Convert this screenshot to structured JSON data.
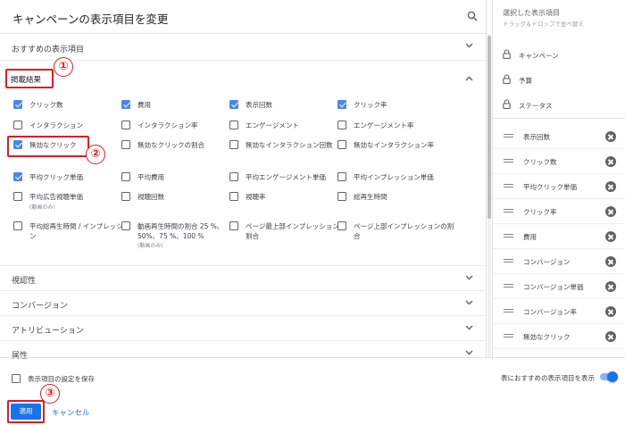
{
  "dialog": {
    "title": "キャンペーンの表示項目を変更"
  },
  "sections": {
    "recommended": "おすすめの表示項目",
    "published": "掲載結果",
    "visibility": "視認性",
    "conversion": "コンバージョン",
    "attribution": "アトリビューション",
    "attributes": "属性"
  },
  "annotations": {
    "one": "①",
    "two": "②",
    "three": "③"
  },
  "metrics": [
    {
      "label": "クリック数",
      "checked": true
    },
    {
      "label": "費用",
      "checked": true
    },
    {
      "label": "表示回数",
      "checked": true
    },
    {
      "label": "クリック率",
      "checked": true
    },
    {
      "label": "インタラクション",
      "checked": false
    },
    {
      "label": "インタラクション率",
      "checked": false
    },
    {
      "label": "エンゲージメント",
      "checked": false
    },
    {
      "label": "エンゲージメント率",
      "checked": false
    },
    {
      "label": "無効なクリック",
      "checked": true
    },
    {
      "label": "無効なクリックの割合",
      "checked": false
    },
    {
      "label": "無効なインタラクション回数",
      "checked": false
    },
    {
      "label": "無効なインタラクション率",
      "checked": false
    },
    {
      "label": "平均クリック単価",
      "checked": true
    },
    {
      "label": "平均費用",
      "checked": false
    },
    {
      "label": "平均エンゲージメント単価",
      "checked": false
    },
    {
      "label": "平均インプレッション単価",
      "checked": false
    },
    {
      "label": "平均広告視聴単価",
      "sub": "(動画のみ)",
      "checked": false
    },
    {
      "label": "視聴回数",
      "checked": false
    },
    {
      "label": "視聴率",
      "checked": false
    },
    {
      "label": "総再生時間",
      "checked": false
    },
    {
      "label": "平均総再生時間 / インプレッション",
      "checked": false
    },
    {
      "label": "動画再生時間の割合 25 %、50%、75 %、100 %",
      "sub": "(動画のみ)",
      "checked": false
    },
    {
      "label": "ページ最上部インプレッションの割合",
      "checked": false
    },
    {
      "label": "ページ上部インプレッションの割合",
      "checked": false
    }
  ],
  "right_panel": {
    "title": "選択した表示項目",
    "subtitle": "ドラッグ＆ドロップで並べ替え",
    "locked": [
      "キャンペーン",
      "予算",
      "ステータス"
    ],
    "selected": [
      "表示回数",
      "クリック数",
      "平均クリック単価",
      "クリック率",
      "費用",
      "コンバージョン",
      "コンバージョン単価",
      "コンバージョン率",
      "無効なクリック"
    ]
  },
  "footer": {
    "save_label": "表示項目の設定を保存",
    "toggle_label": "表におすすめの表示項目を表示",
    "apply": "適用",
    "cancel": "キャンセル"
  },
  "colors": {
    "accent": "#1a73e8",
    "checkbox": "#4b87e6",
    "annotation": "#e01b24"
  }
}
